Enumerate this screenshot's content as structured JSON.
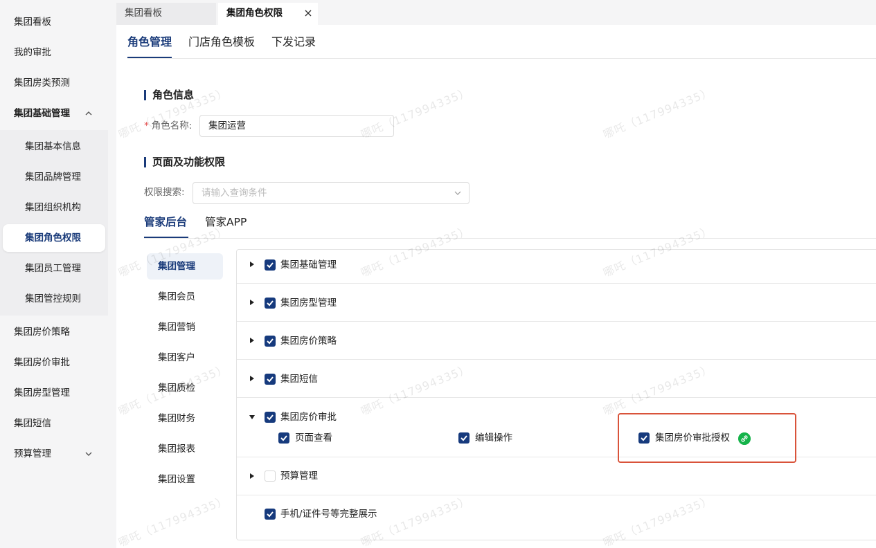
{
  "sidebar": {
    "items": [
      {
        "label": "集团看板"
      },
      {
        "label": "我的审批"
      },
      {
        "label": "集团房类预测"
      },
      {
        "label": "集团基础管理"
      },
      {
        "label": "集团房价策略"
      },
      {
        "label": "集团房价审批"
      },
      {
        "label": "集团房型管理"
      },
      {
        "label": "集团短信"
      },
      {
        "label": "预算管理"
      }
    ],
    "subitems": [
      {
        "label": "集团基本信息"
      },
      {
        "label": "集团品牌管理"
      },
      {
        "label": "集团组织机构"
      },
      {
        "label": "集团角色权限"
      },
      {
        "label": "集团员工管理"
      },
      {
        "label": "集团管控规则"
      }
    ]
  },
  "tabs": [
    {
      "label": "集团看板"
    },
    {
      "label": "集团角色权限"
    }
  ],
  "subtabs": [
    {
      "label": "角色管理"
    },
    {
      "label": "门店角色模板"
    },
    {
      "label": "下发记录"
    }
  ],
  "role_info": {
    "title": "角色信息",
    "name_label": "角色名称:",
    "name_value": "集团运营"
  },
  "permissions": {
    "title": "页面及功能权限",
    "search_label": "权限搜索:",
    "search_placeholder": "请输入查询条件",
    "tabs": [
      {
        "label": "管家后台"
      },
      {
        "label": "管家APP"
      }
    ],
    "modules": [
      {
        "label": "集团管理"
      },
      {
        "label": "集团会员"
      },
      {
        "label": "集团营销"
      },
      {
        "label": "集团客户"
      },
      {
        "label": "集团质检"
      },
      {
        "label": "集团财务"
      },
      {
        "label": "集团报表"
      },
      {
        "label": "集团设置"
      }
    ],
    "rows": [
      {
        "label": "集团基础管理",
        "checked": true,
        "expanded": false
      },
      {
        "label": "集团房型管理",
        "checked": true,
        "expanded": false
      },
      {
        "label": "集团房价策略",
        "checked": true,
        "expanded": false
      },
      {
        "label": "集团短信",
        "checked": true,
        "expanded": false
      },
      {
        "label": "集团房价审批",
        "checked": true,
        "expanded": true,
        "children": [
          {
            "label": "页面查看",
            "checked": true
          },
          {
            "label": "编辑操作",
            "checked": true
          },
          {
            "label": "集团房价审批授权",
            "checked": true,
            "link_icon": "link-icon"
          }
        ]
      },
      {
        "label": "预算管理",
        "checked": false,
        "expanded": false
      },
      {
        "label": "手机/证件号等完整展示",
        "checked": true
      }
    ]
  },
  "watermark": "哪吒（117994335）",
  "colors": {
    "primary": "#1a3b7a",
    "checkbox": "#163a7d",
    "highlight": "#d9533a",
    "link_badge": "#15b34a",
    "required": "#e34d4d"
  }
}
